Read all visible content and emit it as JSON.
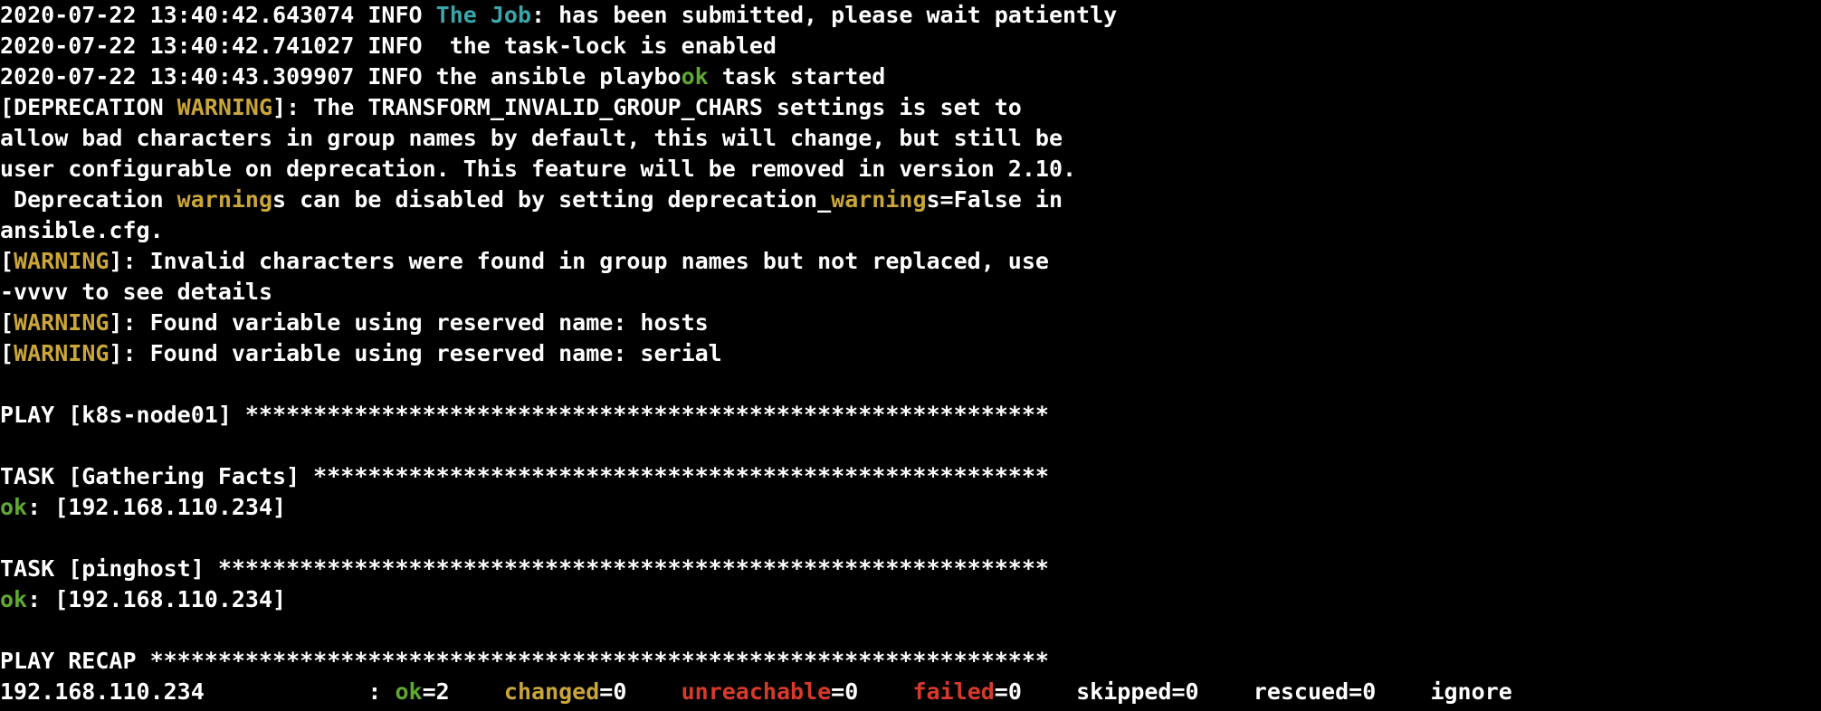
{
  "colors": {
    "background": "#000000",
    "text": "#ffffff",
    "cyan": "#3aa6a9",
    "yellow": "#c9a53a",
    "green": "#5fa832",
    "red": "#d83a2a"
  },
  "log": {
    "l1": {
      "prefix": "2020-07-22 13:40:42.643074 INFO ",
      "job": "The Job",
      "rest": ": has been submitted, please wait patiently"
    },
    "l2": {
      "text": "2020-07-22 13:40:42.741027 INFO  the task-lock is enabled"
    },
    "l3": {
      "prefix": "2020-07-22 13:40:43.309907 INFO the ansible playbo",
      "ok": "ok",
      "rest": " task started"
    }
  },
  "deprecation": {
    "bracket_open": "[DEPRECATION ",
    "warning": "WARNING",
    "after": "]: The TRANSFORM_INVALID_GROUP_CHARS settings is set to",
    "line2": "allow bad characters in group names by default, this will change, but still be",
    "line3": "user configurable on deprecation. This feature will be removed in version 2.10.",
    "line4_a": " Deprecation ",
    "line4_w1": "warning",
    "line4_b": "s can be disabled by setting deprecation_",
    "line4_w2": "warning",
    "line4_c": "s=False in",
    "line5": "ansible.cfg."
  },
  "warnings": {
    "w1": {
      "open": "[",
      "label": "WARNING",
      "text": "]: Invalid characters were found in group names but not replaced, use"
    },
    "w1_cont": "-vvvv to see details",
    "w2": {
      "open": "[",
      "label": "WARNING",
      "text": "]: Found variable using reserved name: hosts"
    },
    "w3": {
      "open": "[",
      "label": "WARNING",
      "text": "]: Found variable using reserved name: serial"
    }
  },
  "play": {
    "header": "PLAY [k8s-node01] ***********************************************************"
  },
  "task_facts": {
    "header": "TASK [Gathering Facts] ******************************************************",
    "ok": "ok",
    "result": ": [192.168.110.234]"
  },
  "task_ping": {
    "header": "TASK [pinghost] *************************************************************",
    "ok": "ok",
    "result": ": [192.168.110.234]"
  },
  "recap": {
    "header": "PLAY RECAP ******************************************************************",
    "host": "192.168.110.234            : ",
    "ok_label": "ok",
    "ok_value": "=2    ",
    "changed_label": "changed",
    "changed_value": "=0    ",
    "unreachable_label": "unreachable",
    "unreachable_value": "=0    ",
    "failed_label": "failed",
    "failed_value": "=0    ",
    "skipped": "skipped=0    ",
    "rescued": "rescued=0    ",
    "ignored": "ignore"
  }
}
